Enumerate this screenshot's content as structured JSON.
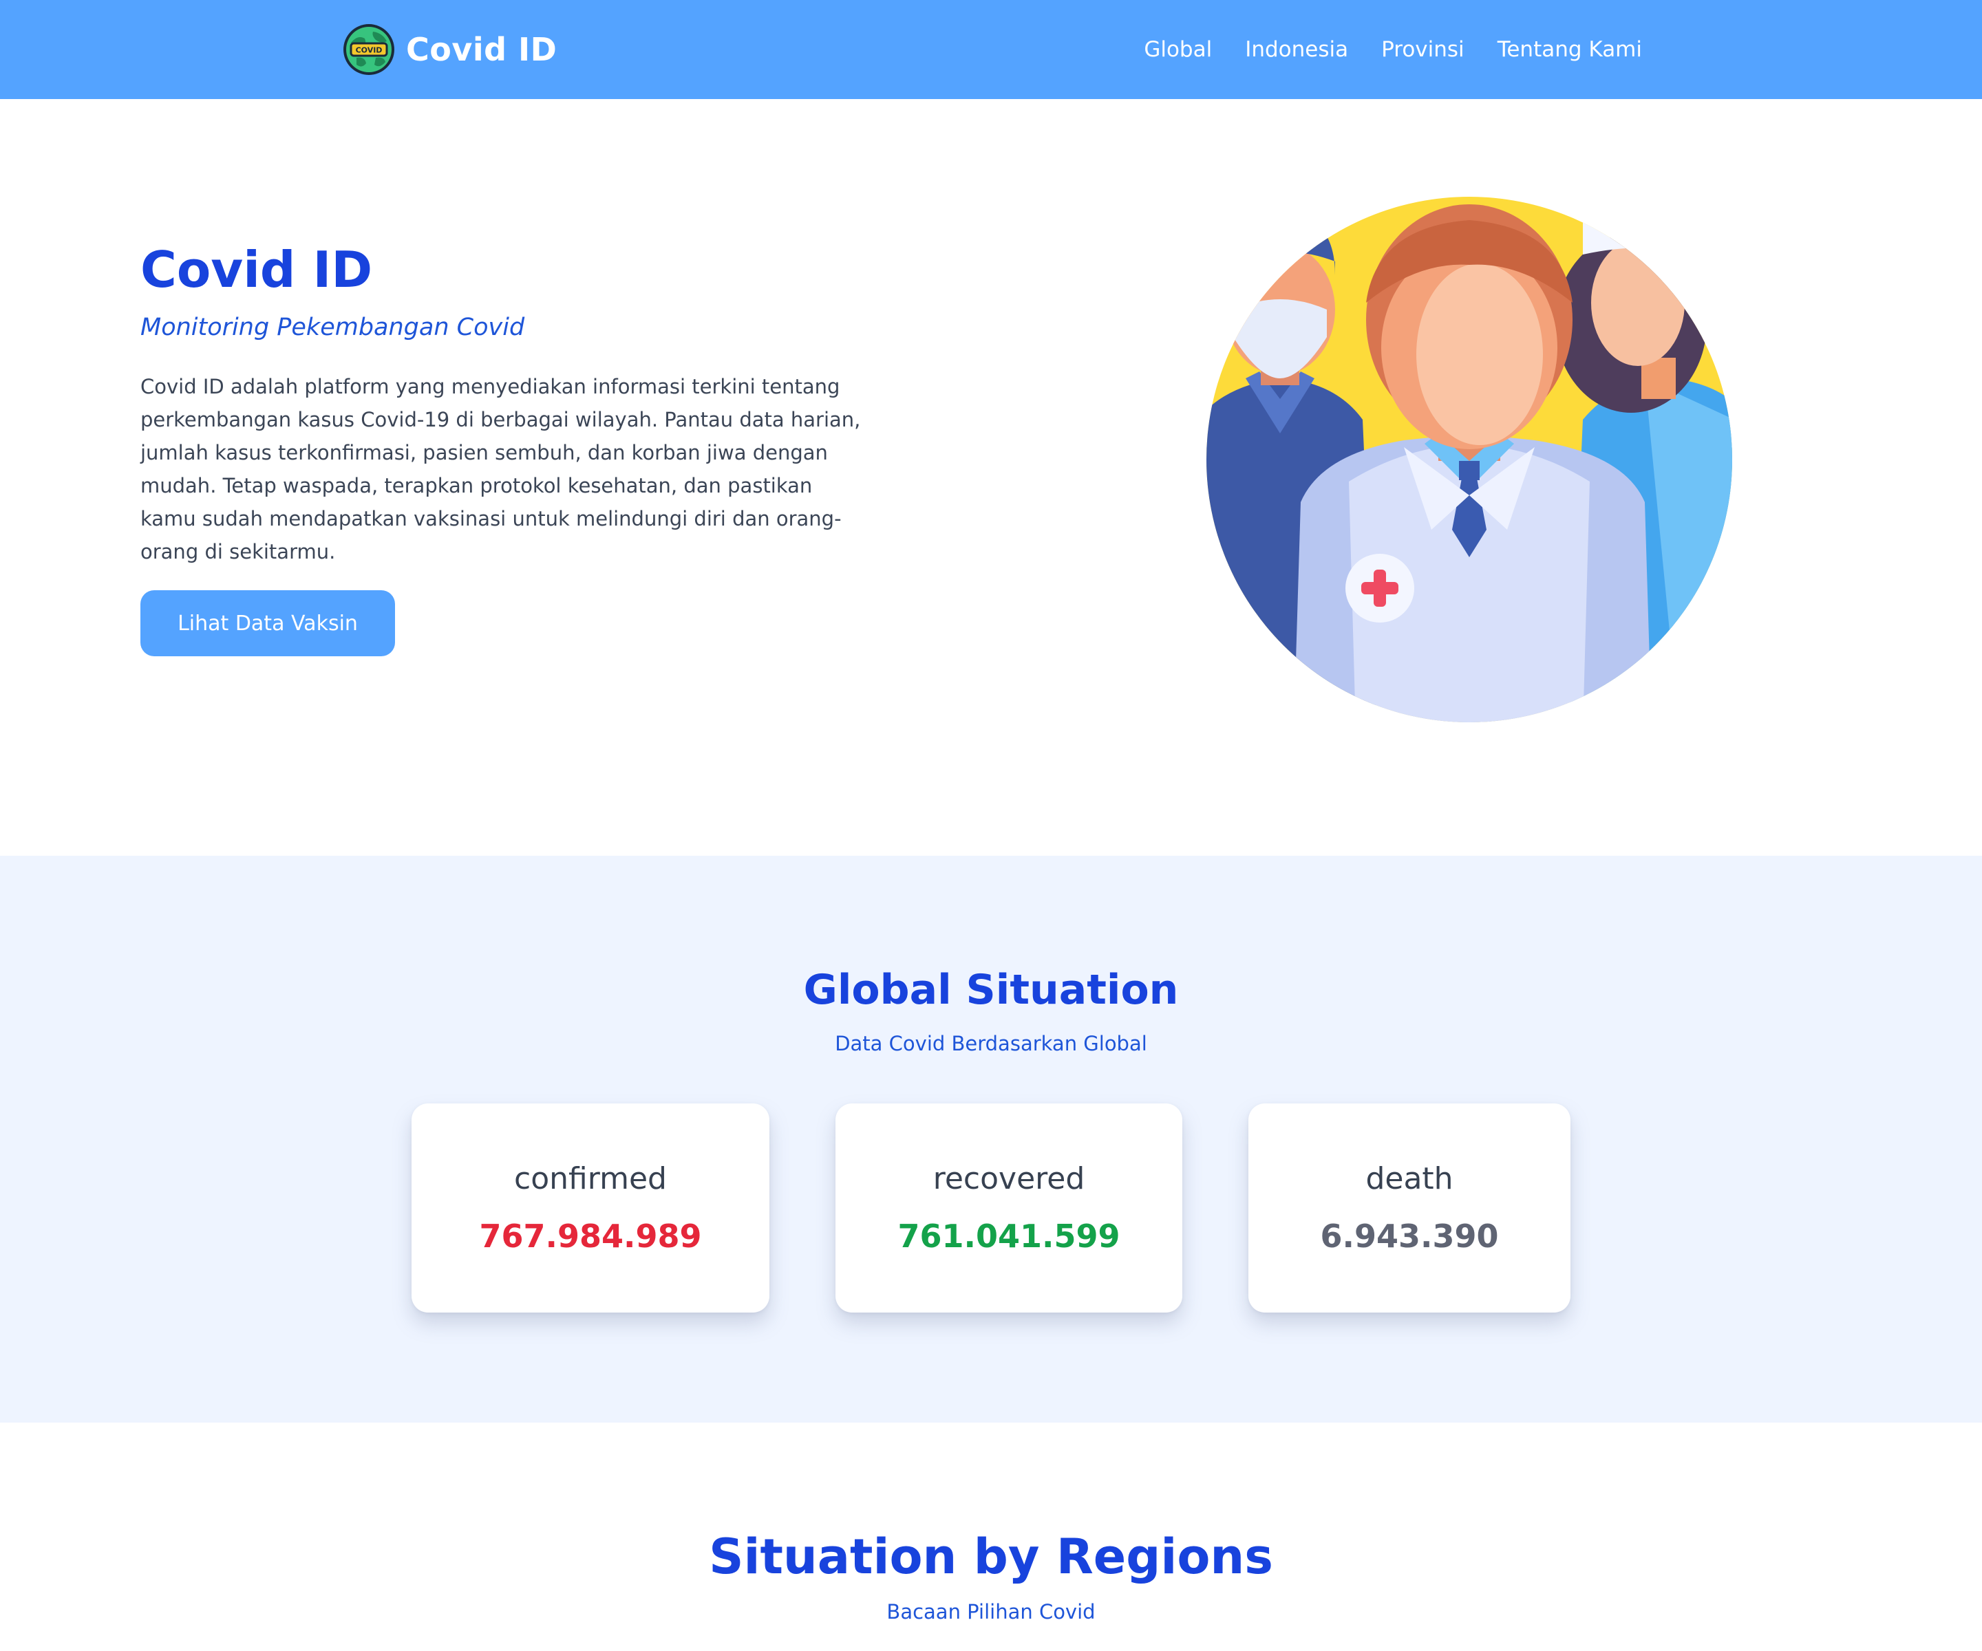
{
  "navbar": {
    "brand": "Covid ID",
    "logo_badge": "COVID",
    "links": [
      "Global",
      "Indonesia",
      "Provinsi",
      "Tentang Kami"
    ]
  },
  "hero": {
    "title": "Covid ID",
    "subtitle": "Monitoring Pekembangan Covid",
    "description": "Covid ID adalah platform yang menyediakan informasi terkini tentang perkembangan kasus Covid-19 di berbagai wilayah. Pantau data harian, jumlah kasus terkonfirmasi, pasien sembuh, dan korban jiwa dengan mudah. Tetap waspada, terapkan protokol kesehatan, dan pastikan kamu sudah mendapatkan vaksinasi untuk melindungi diri dan orang-orang di sekitarmu.",
    "button": "Lihat Data Vaksin"
  },
  "global": {
    "title": "Global Situation",
    "subtitle": "Data Covid Berdasarkan Global",
    "cards": [
      {
        "label": "confirmed",
        "value": "767.984.989",
        "color": "#e5273a"
      },
      {
        "label": "recovered",
        "value": "761.041.599",
        "color": "#14a24a"
      },
      {
        "label": "death",
        "value": "6.943.390",
        "color": "#5f6473"
      }
    ]
  },
  "regions": {
    "title": "Situation by Regions",
    "subtitle": "Bacaan Pilihan Covid"
  },
  "colors": {
    "navbar": "#54a3ff",
    "heading": "#1843dd",
    "section_bg": "#eef4ff"
  }
}
